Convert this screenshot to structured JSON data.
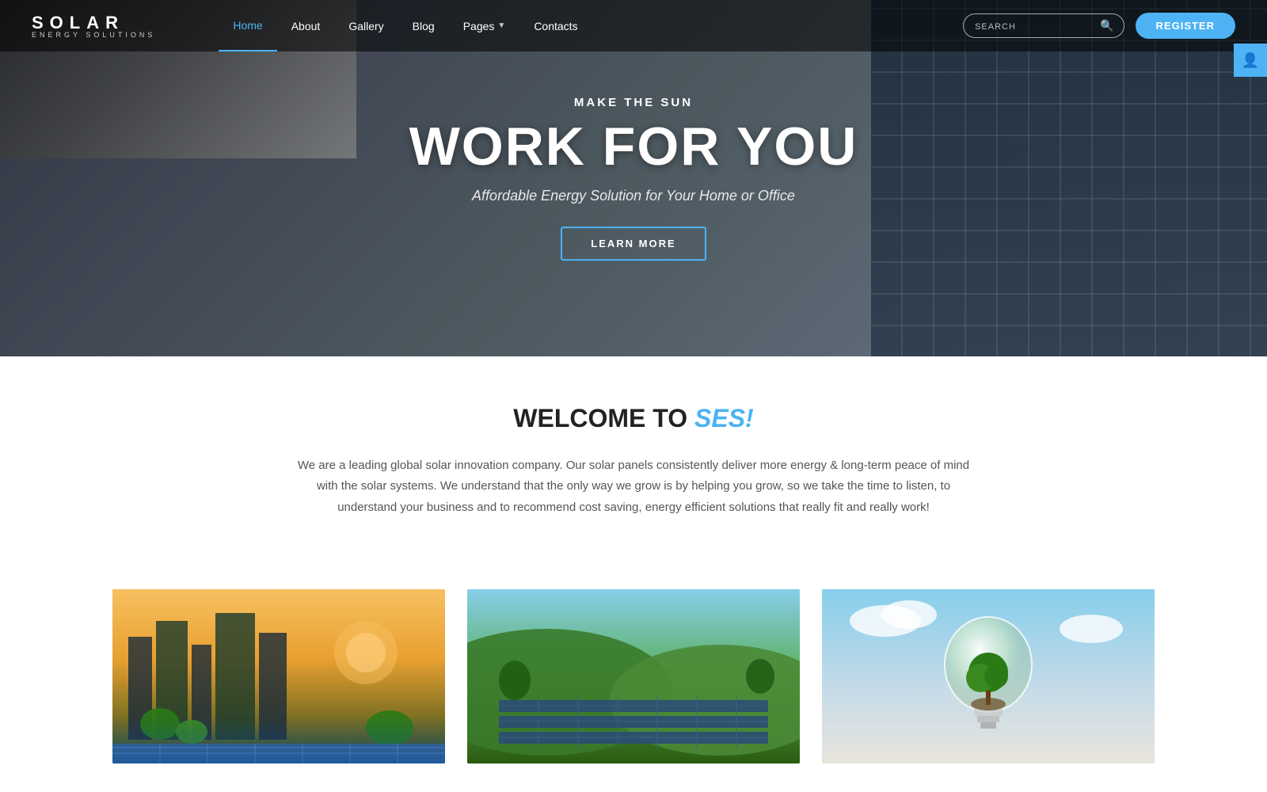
{
  "logo": {
    "main": "SOLAR",
    "sub": "ENERGY SOLUTIONS"
  },
  "nav": {
    "links": [
      {
        "id": "home",
        "label": "Home",
        "active": true
      },
      {
        "id": "about",
        "label": "About",
        "active": false
      },
      {
        "id": "gallery",
        "label": "Gallery",
        "active": false
      },
      {
        "id": "blog",
        "label": "Blog",
        "active": false
      },
      {
        "id": "pages",
        "label": "Pages",
        "active": false,
        "hasDropdown": true
      },
      {
        "id": "contacts",
        "label": "Contacts",
        "active": false
      }
    ],
    "search_placeholder": "SEARCH",
    "register_label": "REGISTER"
  },
  "hero": {
    "subtitle": "MAKE THE SUN",
    "title": "WORK FOR YOU",
    "tagline": "Affordable Energy Solution for Your Home or Office",
    "cta_label": "LEARN MORE"
  },
  "welcome": {
    "title_prefix": "WELCOME TO ",
    "title_accent": "SES!",
    "description": "We are a leading global solar innovation company. Our solar panels consistently deliver more energy & long-term peace of mind with the solar systems. We understand that the only way we grow is by helping you grow, so we take the time to listen, to understand your business and to recommend cost saving, energy efficient solutions that really fit and really work!"
  },
  "cards": [
    {
      "id": "card-city-solar",
      "alt": "City with solar panels"
    },
    {
      "id": "card-field-solar",
      "alt": "Solar panels in green field"
    },
    {
      "id": "card-eco-bulb",
      "alt": "Eco lightbulb with tree"
    }
  ],
  "colors": {
    "accent": "#4db3f5",
    "dark": "#222222",
    "text": "#555555"
  }
}
